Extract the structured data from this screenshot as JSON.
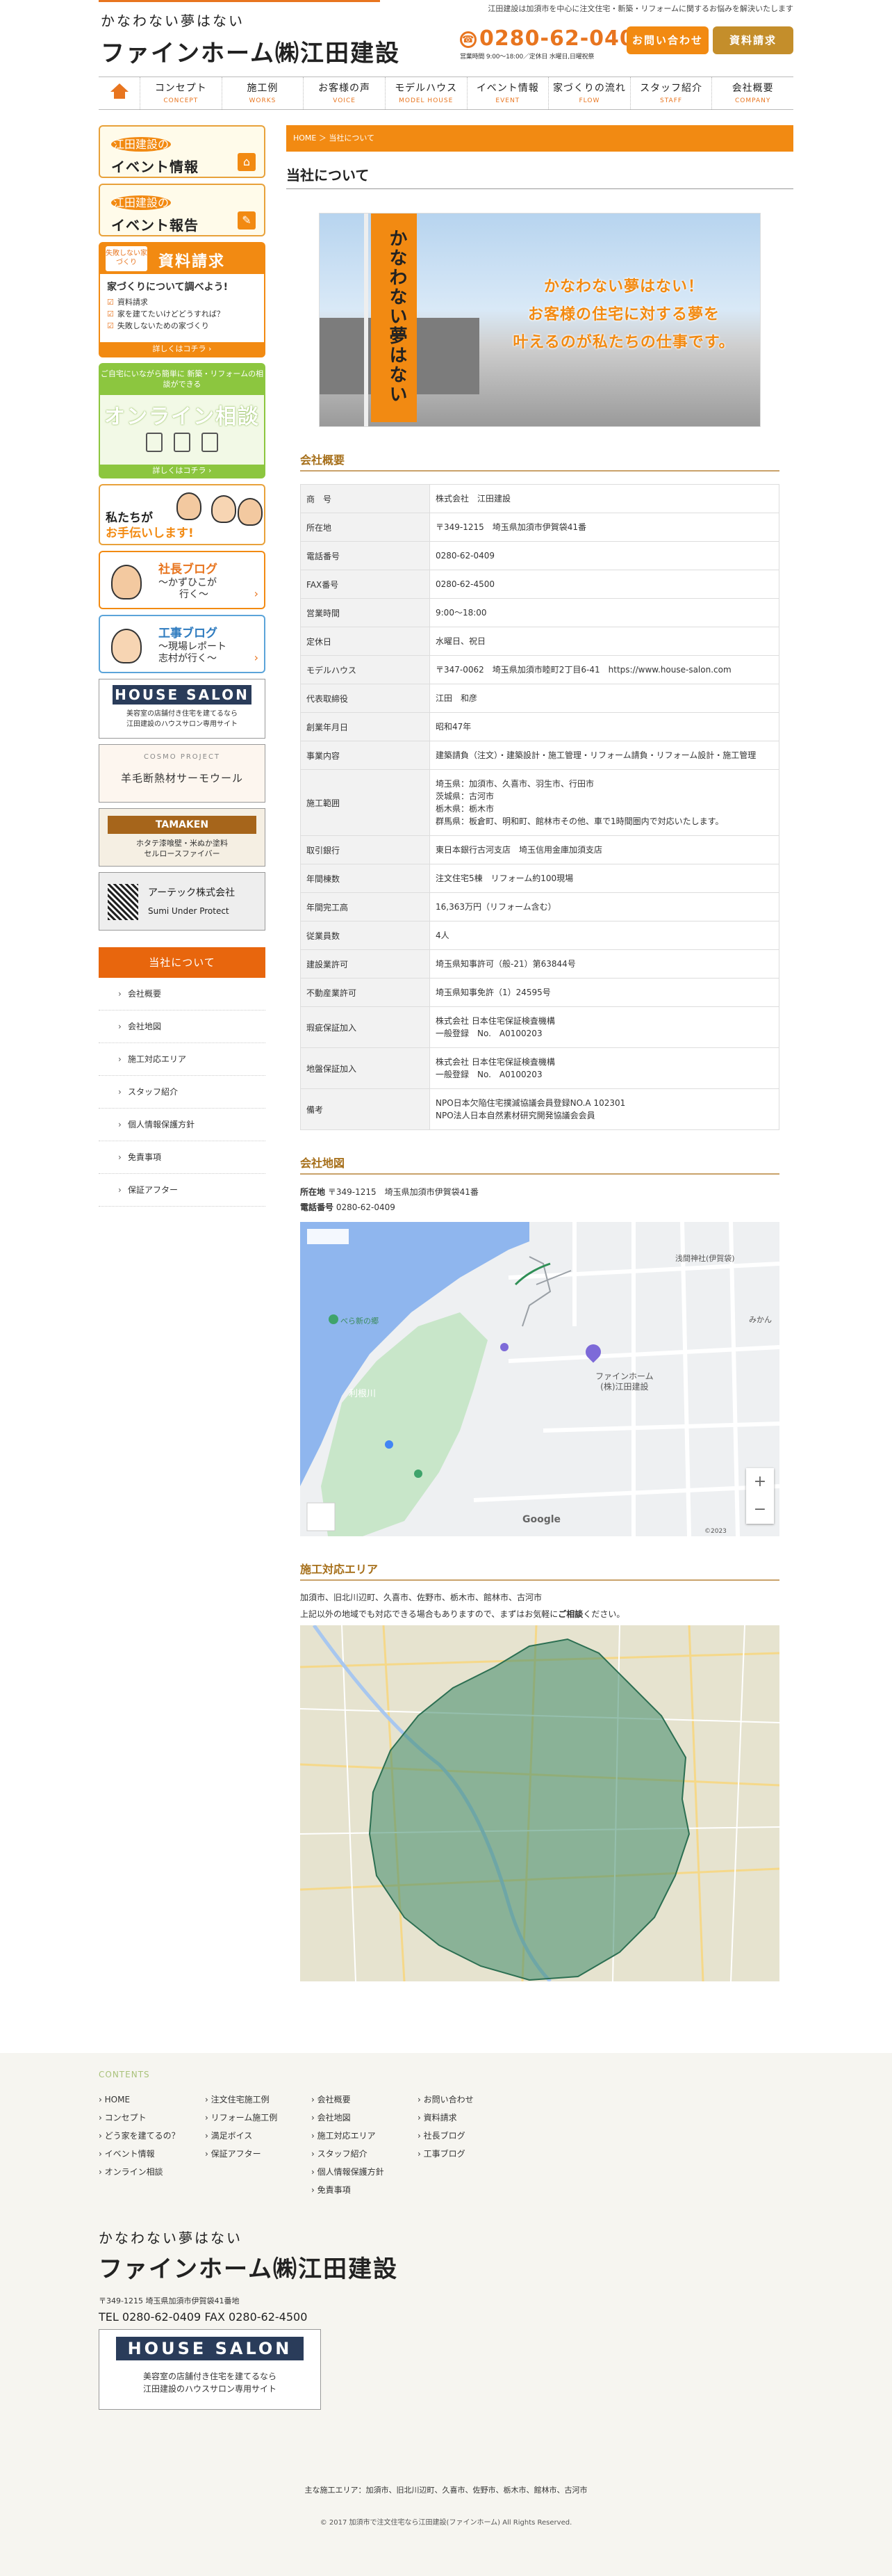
{
  "header": {
    "tagline": "かなわない夢はない",
    "company": "ファインホーム㈱江田建設",
    "description": "江田建設は加須市を中心に注文住宅・新築・リフォームに関するお悩みを解決いたします",
    "tel": "0280-62-0409",
    "hours": "営業時間 9:00～18:00／定休日 水曜日,日曜祝祭",
    "inquiry_label": "お問い合わせ",
    "request_label": "資料請求"
  },
  "nav": [
    {
      "jp": "コンセプト",
      "en": "CONCEPT"
    },
    {
      "jp": "施工例",
      "en": "WORKS"
    },
    {
      "jp": "お客様の声",
      "en": "VOICE"
    },
    {
      "jp": "モデルハウス",
      "en": "MODEL HOUSE"
    },
    {
      "jp": "イベント情報",
      "en": "EVENT"
    },
    {
      "jp": "家づくりの流れ",
      "en": "FLOW"
    },
    {
      "jp": "スタッフ紹介",
      "en": "STAFF"
    },
    {
      "jp": "会社概要",
      "en": "COMPANY"
    }
  ],
  "sidebar": {
    "event_info": {
      "company": "江田建設の",
      "title": "イベント情報"
    },
    "event_report": {
      "company": "江田建設の",
      "title": "イベント報告"
    },
    "shiryo": {
      "badge": "失敗しない家づくり",
      "title": "資料請求",
      "subtitle": "家づくりについて調べよう!",
      "items": [
        "資料請求",
        "家を建てたいけどどうすれば？",
        "失敗しないための家づくり"
      ],
      "more": "詳しくはコチラ ›"
    },
    "online": {
      "lead": "ご自宅にいながら簡単に 新築・リフォームの相談ができる",
      "title": "オンライン相談",
      "more": "詳しくはコチラ ›"
    },
    "tetsudai": {
      "l1": "私たちが",
      "l2": "お手伝いします!"
    },
    "president_blog": {
      "title": "社長ブログ",
      "sub1": "～かずひこが",
      "sub2": "行く～"
    },
    "koji_blog": {
      "title": "工事ブログ",
      "sub1": "～現場レポート",
      "sub2": "志村が行く～"
    },
    "house_salon": {
      "logo": "HOUSE SALON",
      "d1": "美容室の店舗付き住宅を建てるなら",
      "d2": "江田建設のハウスサロン専用サイト"
    },
    "cosmo": {
      "top": "COSMO PROJECT",
      "main": "羊毛断熱材サーモウール"
    },
    "tamaken": {
      "logo": "TAMAKEN",
      "d1": "ホタテ漆喰壁・米ぬか塗料",
      "d2": "セルロースファイバー"
    },
    "artec": {
      "name": "アーテック株式会社",
      "product": "Sumi Under Protect"
    },
    "submenu": {
      "heading": "当社について",
      "items": [
        "会社概要",
        "会社地図",
        "施工対応エリア",
        "スタッフ紹介",
        "個人情報保護方針",
        "免責事項",
        "保証アフター"
      ]
    }
  },
  "main": {
    "breadcrumb": "HOME ＞ 当社について",
    "title": "当社について",
    "hero": {
      "flag": "かなわない夢はない",
      "l1": "かなわない夢はない！",
      "l2": "お客様の住宅に対する夢を",
      "l3": "叶えるのが私たちの仕事です。"
    },
    "overview_heading": "会社概要",
    "overview": [
      {
        "k": "商　号",
        "v": [
          "株式会社　江田建設"
        ]
      },
      {
        "k": "所在地",
        "v": [
          "〒349-1215　埼玉県加須市伊賀袋41番"
        ]
      },
      {
        "k": "電話番号",
        "v": [
          "0280-62-0409"
        ]
      },
      {
        "k": "FAX番号",
        "v": [
          "0280-62-4500"
        ]
      },
      {
        "k": "営業時間",
        "v": [
          "9:00～18:00"
        ]
      },
      {
        "k": "定休日",
        "v": [
          "水曜日、祝日"
        ]
      },
      {
        "k": "モデルハウス",
        "v": [
          "〒347-0062　埼玉県加須市睦町2丁目6-41　https://www.house-salon.com"
        ]
      },
      {
        "k": "代表取締役",
        "v": [
          "江田　和彦"
        ]
      },
      {
        "k": "創業年月日",
        "v": [
          "昭和47年"
        ]
      },
      {
        "k": "事業内容",
        "v": [
          "建築請負（注文）・建築設計・施工管理・リフォーム請負・リフォーム設計・施工管理"
        ]
      },
      {
        "k": "施工範囲",
        "v": [
          "埼玉県：加須市、久喜市、羽生市、行田市",
          "茨城県：古河市",
          "栃木県：栃木市",
          "群馬県：板倉町、明和町、館林市その他、車で1時間圏内で対応いたします。"
        ]
      },
      {
        "k": "取引銀行",
        "v": [
          "東日本銀行古河支店　埼玉信用金庫加須支店"
        ]
      },
      {
        "k": "年間棟数",
        "v": [
          "注文住宅5棟　リフォーム約100現場"
        ]
      },
      {
        "k": "年間完工高",
        "v": [
          "16,363万円（リフォーム含む）"
        ]
      },
      {
        "k": "従業員数",
        "v": [
          "4人"
        ]
      },
      {
        "k": "建設業許可",
        "v": [
          "埼玉県知事許可（般-21）第63844号"
        ]
      },
      {
        "k": "不動産業許可",
        "v": [
          "埼玉県知事免許（1）24595号"
        ]
      },
      {
        "k": "瑕疵保証加入",
        "v": [
          "株式会社 日本住宅保証検査機構",
          "一般登録　No.　A0100203"
        ]
      },
      {
        "k": "地盤保証加入",
        "v": [
          "株式会社 日本住宅保証検査機構",
          "一般登録　No.　A0100203"
        ]
      },
      {
        "k": "備考",
        "v": [
          "NPO日本欠陥住宅撲滅協議会員登録NO.A 102301",
          "NPO法人日本自然素材研究開発協議会会員"
        ]
      }
    ],
    "map_heading": "会社地図",
    "map_address_label": "所在地",
    "map_address": "〒349-1215　埼玉県加須市伊賀袋41番",
    "map_tel_label": "電話番号",
    "map_tel": "0280-62-0409",
    "map": {
      "marker_label_1": "ファインホーム",
      "marker_label_2": "(株)江田建設",
      "poi_1": "べら新の郷",
      "poi_2": "浅間神社(伊賀袋)",
      "poi_3": "みかん",
      "river": "利根川",
      "google": "Google",
      "copyright": "©2023"
    },
    "area_heading": "施工対応エリア",
    "area_line1": "加須市、旧北川辺町、久喜市、佐野市、栃木市、館林市、古河市",
    "area_line2_pre": "上記以外の地域でも対応できる場合もありますので、まずはお気軽に",
    "area_line2_bold": "ご相談",
    "area_line2_post": "ください。"
  },
  "footer": {
    "contents_label": "CONTENTS",
    "cols": [
      [
        "HOME",
        "コンセプト",
        "どう家を建てるの？",
        "イベント情報",
        "オンライン相談"
      ],
      [
        "注文住宅施工例",
        "リフォーム施工例",
        "満足ボイス",
        "保証アフター"
      ],
      [
        "会社概要",
        "会社地図",
        "施工対応エリア",
        "スタッフ紹介",
        "個人情報保護方針",
        "免責事項"
      ],
      [
        "お問い合わせ",
        "資料請求",
        "社長ブログ",
        "工事ブログ"
      ]
    ],
    "tagline": "かなわない夢はない",
    "company": "ファインホーム㈱江田建設",
    "address": "〒349-1215 埼玉県加須市伊賀袋41番地",
    "telfax": "TEL 0280-62-0409 FAX 0280-62-4500",
    "hs_logo": "HOUSE SALON",
    "hs_d1": "美容室の店舗付き住宅を建てるなら",
    "hs_d2": "江田建設のハウスサロン専用サイト",
    "area": "主な施工エリア：加須市、旧北川辺町、久喜市、佐野市、栃木市、館林市、古河市",
    "copyright": "© 2017 加須市で注文住宅なら江田建設(ファインホーム) All Rights Reserved."
  },
  "colors": {
    "accent": "#f28a12",
    "accent_dark": "#e8660d",
    "heading_brown": "#a66f1a",
    "online_green": "#8cc63f",
    "map_water": "#8fb6ee",
    "area_green": "#3e8a6a"
  }
}
